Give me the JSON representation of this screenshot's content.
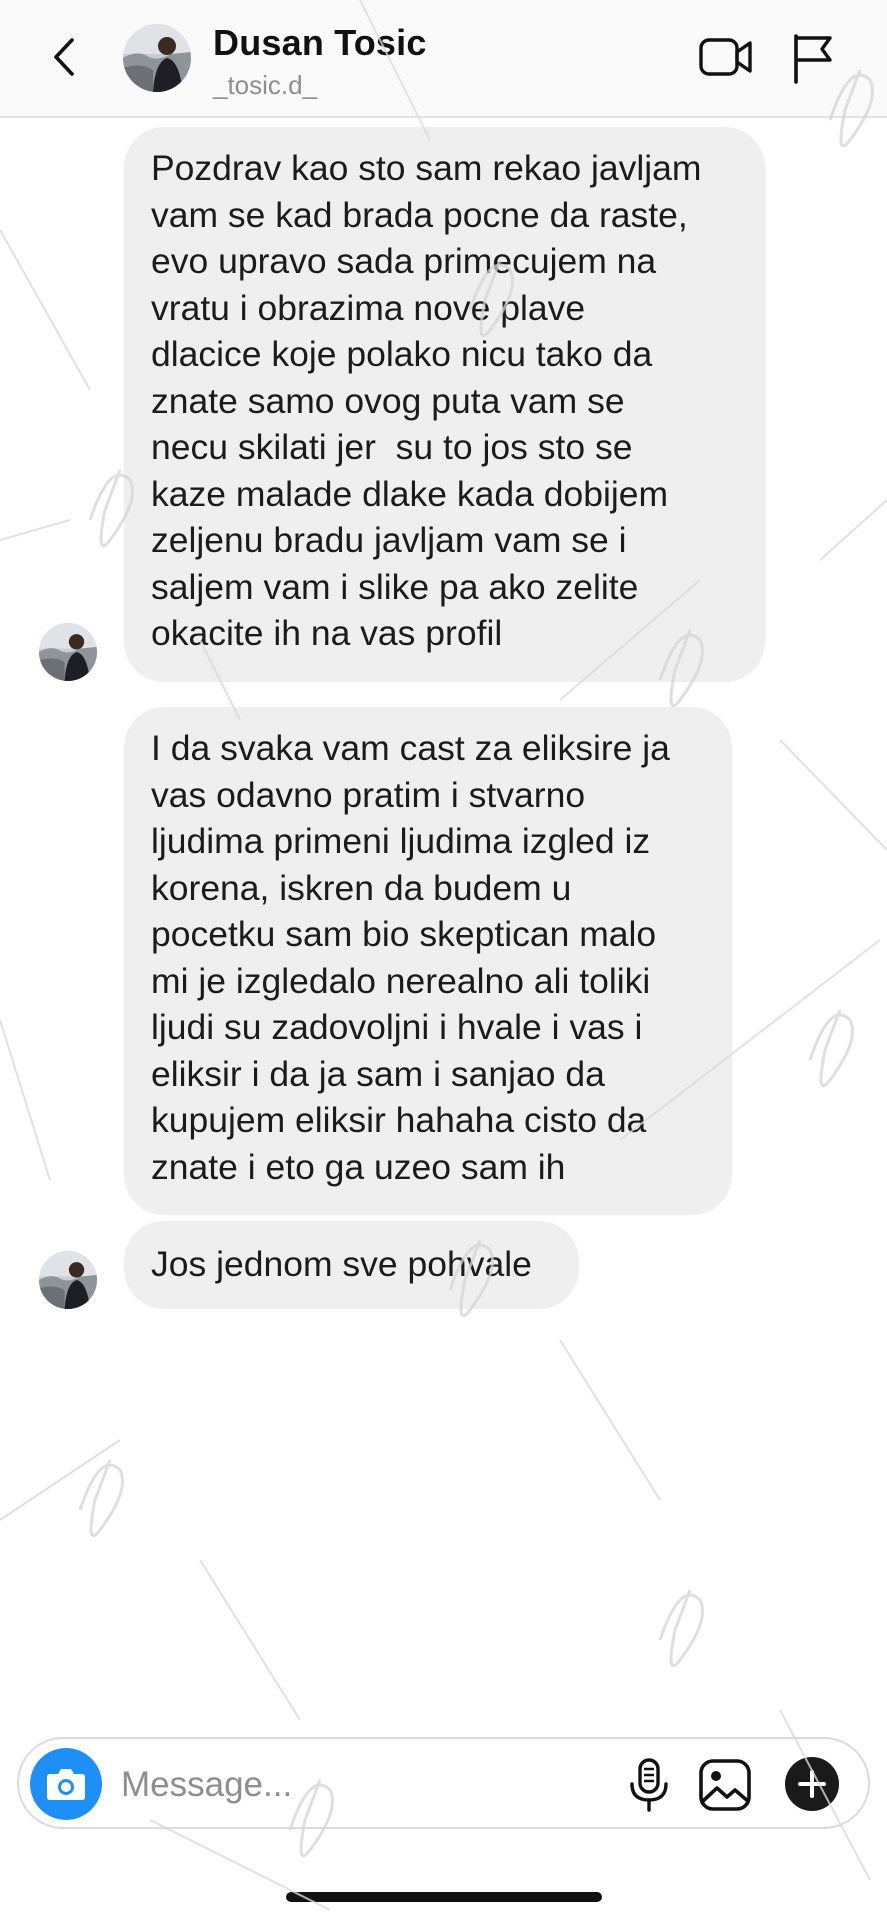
{
  "header": {
    "name": "Dusan Tosic",
    "handle": "_tosic.d_"
  },
  "messages": [
    {
      "lines": [
        "Pozdrav kao sto sam rekao javljam",
        "vam se kad brada pocne da raste,",
        "evo upravo sada primecujem na",
        "vratu i obrazima nove plave",
        "dlacice koje polako nicu tako da",
        "znate samo ovog puta vam se",
        "necu skilati jer  su to jos sto se",
        "kaze malade dlake kada dobijem",
        "zeljenu bradu javljam vam se i",
        "saljem vam i slike pa ako zelite",
        "okacite ih na vas profil"
      ]
    },
    {
      "lines": [
        "I da svaka vam cast za eliksire ja",
        "vas odavno pratim i stvarno",
        "ljudima primeni ljudima izgled iz",
        "korena, iskren da budem u",
        "pocetku sam bio skeptican malo",
        "mi je izgledalo nerealno ali toliki",
        "ljudi su zadovoljni i hvale i vas i",
        "eliksir i da ja sam i sanjao da",
        "kupujem eliksir hahaha cisto da",
        "znate i eto ga uzeo sam ih"
      ]
    },
    {
      "lines": [
        "Jos jednom sve pohvale"
      ]
    }
  ],
  "composer": {
    "placeholder": "Message..."
  },
  "icons": {
    "back": "chevron-left-icon",
    "video": "video-call-icon",
    "flag": "flag-icon",
    "camera": "camera-icon",
    "mic": "microphone-icon",
    "gallery": "gallery-icon",
    "plus": "plus-icon"
  },
  "colors": {
    "bubble": "#efefef",
    "camera_button": "#1e8ff6",
    "placeholder": "#8e8e8e",
    "handle": "#8e8e8e"
  }
}
